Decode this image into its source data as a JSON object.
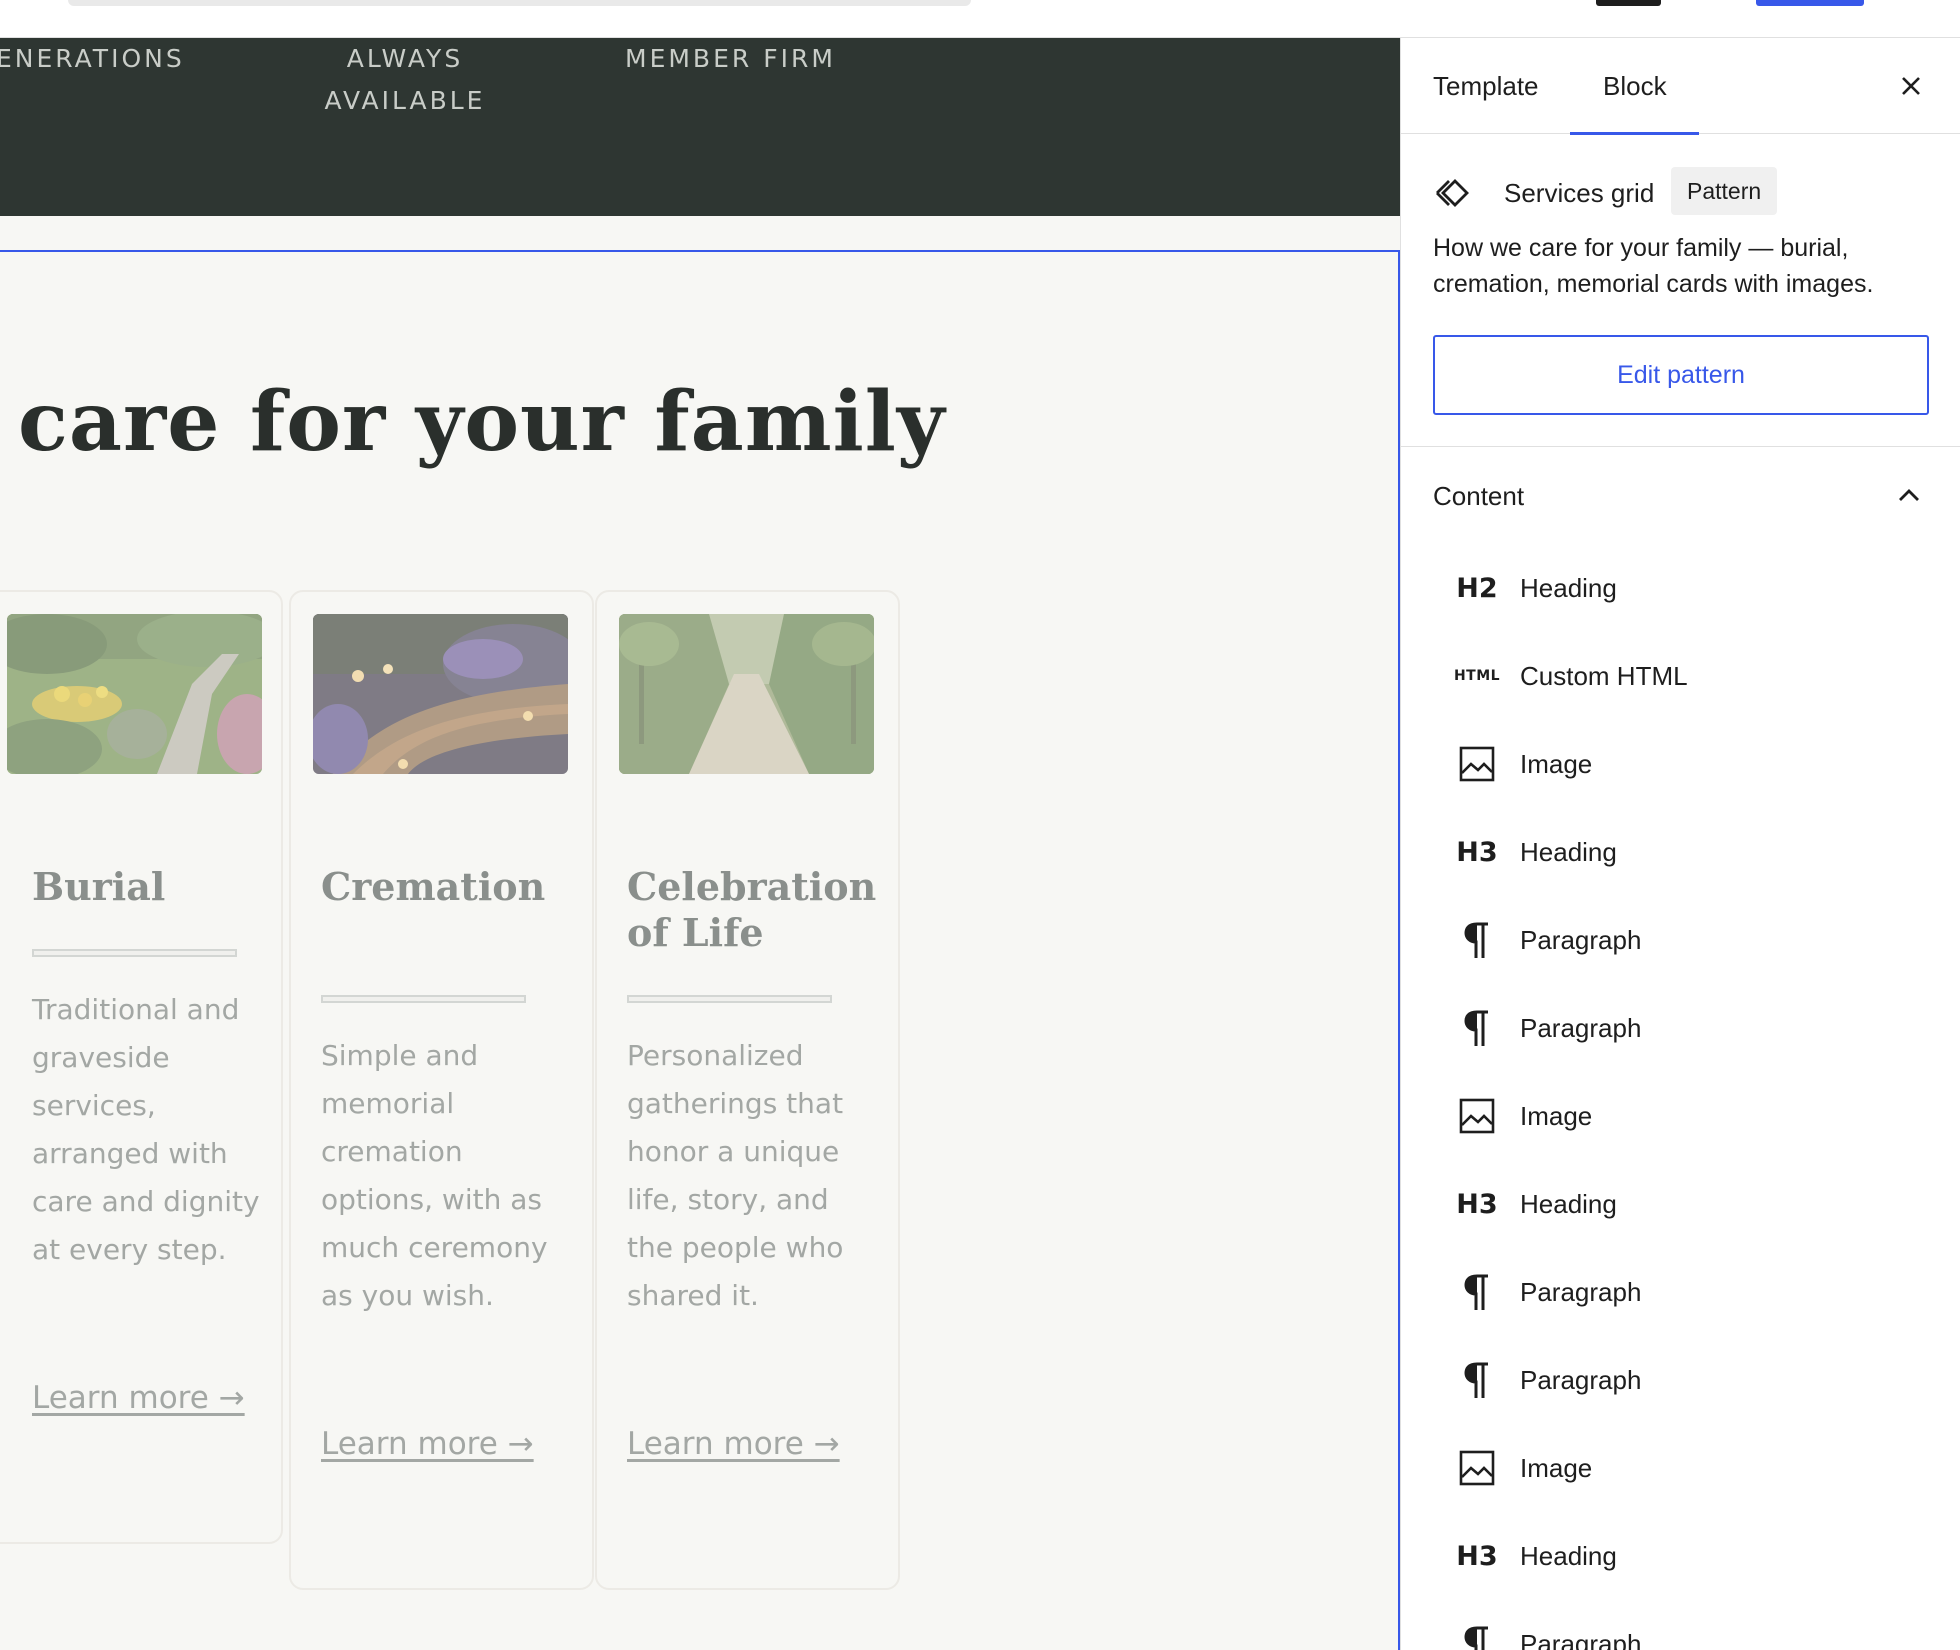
{
  "band": {
    "items": [
      "ENERATIONS",
      "ALWAYS\nAVAILABLE",
      "MEMBER FIRM"
    ]
  },
  "section": {
    "heading": "care for your family"
  },
  "cards": [
    {
      "title": "Burial",
      "description": "Traditional and graveside services, arranged with care and dignity at every step.",
      "link": "Learn more →",
      "image": "garden-path-photo"
    },
    {
      "title": "Cremation",
      "description": "Simple and memorial cremation options, with as much ceremony as you wish.",
      "link": "Learn more →",
      "image": "lit-walkway-photo"
    },
    {
      "title": "Celebration of Life",
      "description": "Personalized gatherings that honor a unique life, story, and the people who shared it.",
      "link": "Learn more →",
      "image": "tree-lined-path-photo"
    }
  ],
  "sidebar": {
    "tabs": [
      "Template",
      "Block"
    ],
    "active_tab": "Block",
    "close_icon": "close-icon",
    "block": {
      "icon": "pattern-icon",
      "name": "Services grid",
      "badge": "Pattern",
      "description": "How we care for your family — burial, cremation, memorial cards with images.",
      "edit_label": "Edit pattern"
    },
    "content": {
      "title": "Content",
      "expanded": true,
      "items": [
        {
          "icon": "H2",
          "label": "Heading"
        },
        {
          "icon": "HTML",
          "label": "Custom HTML"
        },
        {
          "icon": "image-icon",
          "label": "Image"
        },
        {
          "icon": "H3",
          "label": "Heading"
        },
        {
          "icon": "paragraph-icon",
          "label": "Paragraph"
        },
        {
          "icon": "paragraph-icon",
          "label": "Paragraph"
        },
        {
          "icon": "image-icon",
          "label": "Image"
        },
        {
          "icon": "H3",
          "label": "Heading"
        },
        {
          "icon": "paragraph-icon",
          "label": "Paragraph"
        },
        {
          "icon": "paragraph-icon",
          "label": "Paragraph"
        },
        {
          "icon": "image-icon",
          "label": "Image"
        },
        {
          "icon": "H3",
          "label": "Heading"
        },
        {
          "icon": "paragraph-icon",
          "label": "Paragraph"
        }
      ]
    }
  },
  "colors": {
    "accent": "#3858e9",
    "band": "#2e3632",
    "canvas": "#f7f7f4",
    "heading": "#2a2f2c",
    "muted_text": "#a3a7a4"
  }
}
